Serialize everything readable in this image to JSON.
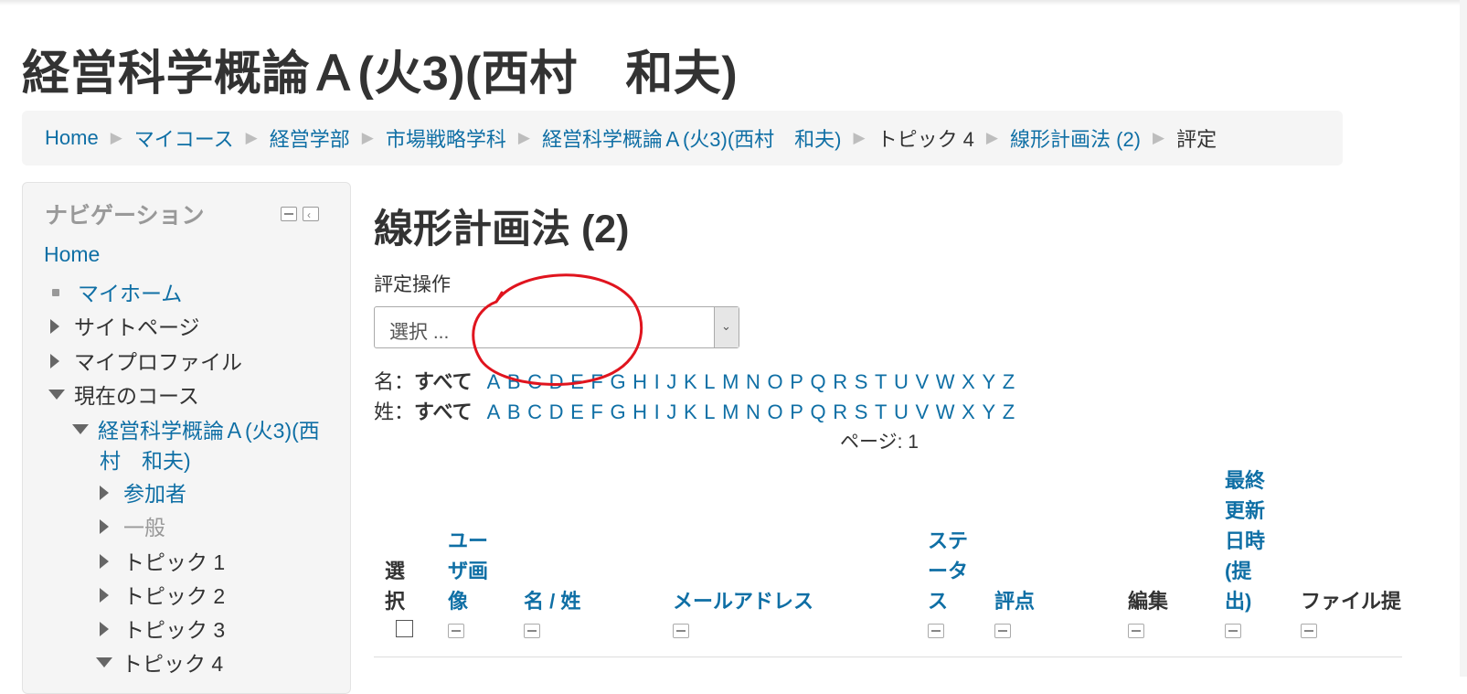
{
  "page_title": "経営科学概論Ａ(火3)(西村　和夫)",
  "breadcrumb": [
    {
      "label": "Home",
      "link": true
    },
    {
      "label": "マイコース",
      "link": true
    },
    {
      "label": "経営学部",
      "link": true
    },
    {
      "label": "市場戦略学科",
      "link": true
    },
    {
      "label": "経営科学概論Ａ(火3)(西村　和夫)",
      "link": true
    },
    {
      "label": "トピック 4",
      "link": false
    },
    {
      "label": "線形計画法 (2)",
      "link": true
    },
    {
      "label": "評定",
      "link": false
    }
  ],
  "breadcrumb_separator": "▶",
  "navigation": {
    "title": "ナビゲーション",
    "home": "Home",
    "my_home": "マイホーム",
    "site_pages": "サイトページ",
    "my_profile": "マイプロファイル",
    "current_course": "現在のコース",
    "course_line1": "経営科学概論Ａ(火3)(西",
    "course_line2": "村　和夫)",
    "participants": "参加者",
    "general": "一般",
    "topic1": "トピック 1",
    "topic2": "トピック 2",
    "topic3": "トピック 3",
    "topic4": "トピック 4"
  },
  "main": {
    "heading": "線形計画法 (2)",
    "grading_action_label": "評定操作",
    "grading_select_value": "選択 ...",
    "firstname_label": "名：",
    "lastname_label": "姓：",
    "all_label": "すべて",
    "letters": [
      "A",
      "B",
      "C",
      "D",
      "E",
      "F",
      "G",
      "H",
      "I",
      "J",
      "K",
      "L",
      "M",
      "N",
      "O",
      "P",
      "Q",
      "R",
      "S",
      "T",
      "U",
      "V",
      "W",
      "X",
      "Y",
      "Z"
    ],
    "paging": "ページ:  1"
  },
  "table": {
    "headers": {
      "select": "選択",
      "user_picture": "ユーザ画像",
      "name": "名 / 姓",
      "email": "メールアドレス",
      "status": "ステータス",
      "grade": "評点",
      "edit": "編集",
      "last_modified": "最終更新日時(提出)",
      "file_submissions": "ファイル提"
    }
  },
  "colors": {
    "link": "#0f6fa5",
    "annotation": "#e0141e",
    "breadcrumb_bg": "#f5f5f5"
  },
  "icons": {
    "dropdown": "chevron-down-icon",
    "collapse": "collapse-icon",
    "dock": "dock-icon"
  }
}
